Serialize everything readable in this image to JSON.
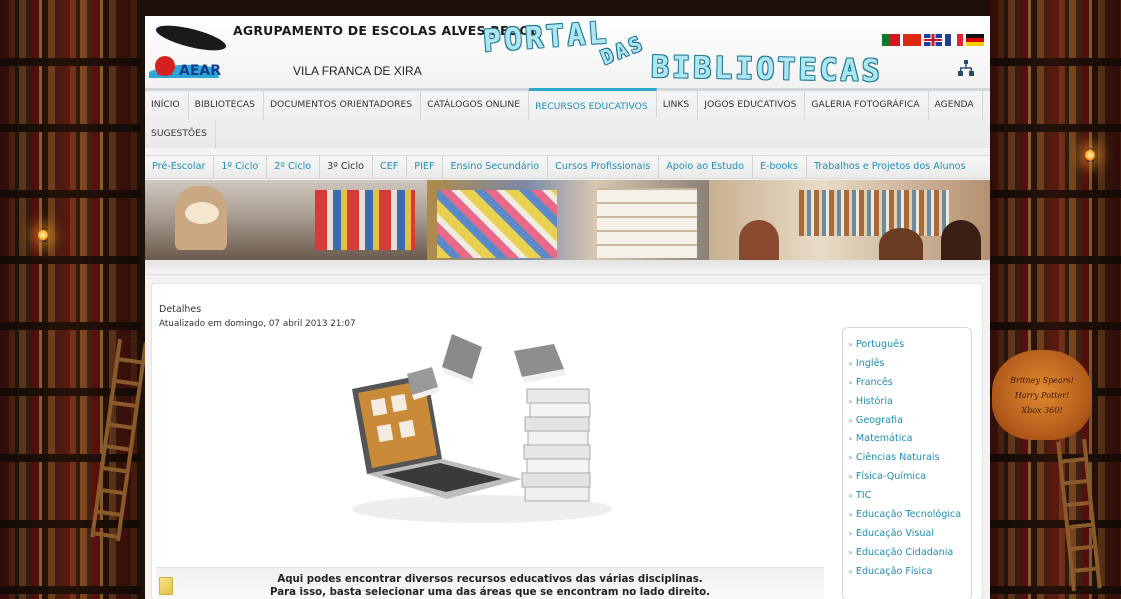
{
  "header": {
    "school_name": "AGRUPAMENTO DE ESCOLAS ALVES REDOL",
    "school_city": "VILA FRANCA DE XIRA",
    "logo_text": "AEAR",
    "portal_title_1": "PORTAL",
    "portal_title_2": "DAS",
    "portal_title_3": "BIBLIOTECAS",
    "languages": [
      "pt",
      "cn",
      "gb",
      "fr",
      "de"
    ]
  },
  "main_nav": {
    "items": [
      "INÍCIO",
      "BIBLIOTECAS",
      "DOCUMENTOS ORIENTADORES",
      "CATÁLOGOS ONLINE",
      "RECURSOS EDUCATIVOS",
      "LINKS",
      "JOGOS EDUCATIVOS",
      "GALERIA FOTOGRÁFICA",
      "AGENDA",
      "SUGESTÕES"
    ],
    "active_index": 4
  },
  "sub_nav": {
    "items": [
      "Pré-Escolar",
      "1º Ciclo",
      "2º Ciclo",
      "3º Ciclo",
      "CEF",
      "PIEF",
      "Ensino Secundário",
      "Cursos Profissionais",
      "Apoio ao Estudo",
      "E-books",
      "Trabalhos e Projetos dos Alunos"
    ],
    "current_index": 3
  },
  "decor": {
    "sign_line_1": "Britney Spears!",
    "sign_line_2": "Harry Potter!",
    "sign_line_3": "Xbox 360!"
  },
  "content": {
    "details_label": "Detalhes",
    "updated_label": "Atualizado em domingo, 07 abril 2013 21:07",
    "description_line_1": "Aqui podes encontrar diversos recursos educativos das várias disciplinas.",
    "description_line_2": "Para isso, basta selecionar uma das áreas que se encontram no lado direito."
  },
  "sidebar": {
    "bullet": "»",
    "items": [
      "Português",
      "Inglês",
      "Francês",
      "História",
      "Geografia",
      "Matemática",
      "Ciências Naturais",
      "Física-Química",
      "TIC",
      "Educação Tecnológica",
      "Educação Visual",
      "Educação Cidadania",
      "Educação Física"
    ]
  },
  "colors": {
    "accent": "#1f8fb2",
    "portal_title": "#aee6f0",
    "background": "#1c0f08"
  }
}
